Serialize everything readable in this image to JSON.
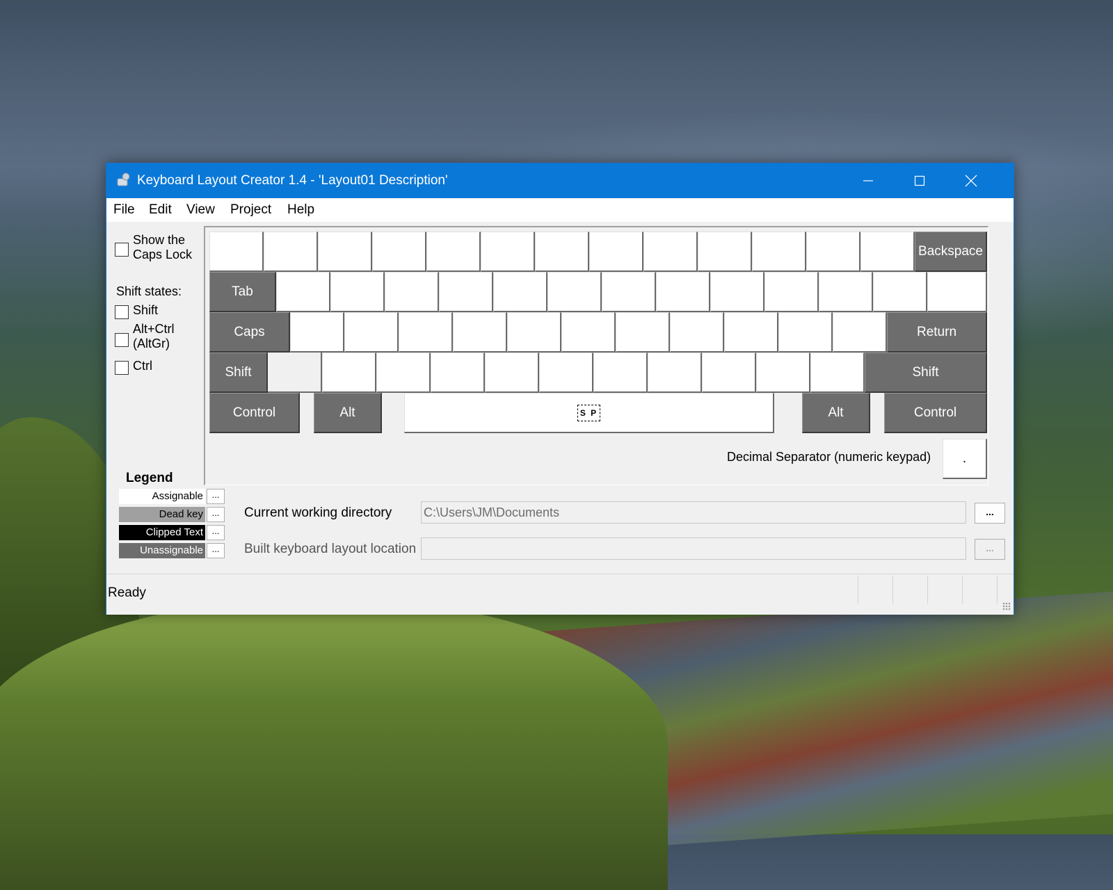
{
  "window": {
    "title": "Keyboard Layout Creator 1.4 - 'Layout01 Description'"
  },
  "menu": [
    "File",
    "Edit",
    "View",
    "Project",
    "Help"
  ],
  "side": {
    "caps_lock": [
      "Show the",
      "Caps Lock"
    ],
    "shift_states_title": "Shift states:",
    "shift": "Shift",
    "altgr": [
      "Alt+Ctrl",
      "(AltGr)"
    ],
    "ctrl": "Ctrl"
  },
  "keyboard": {
    "row1_last": "Backspace",
    "row2_first": "Tab",
    "row3_first": "Caps",
    "row3_last": "Return",
    "row4_first": "Shift",
    "row4_last": "Shift",
    "row5": [
      "Control",
      "Alt",
      "S P",
      "Alt",
      "Control"
    ],
    "decimal_label": "Decimal Separator (numeric keypad)",
    "decimal_value": "."
  },
  "legend": {
    "title": "Legend",
    "items": [
      "Assignable",
      "Dead key",
      "Clipped Text",
      "Unassignable"
    ],
    "button": "..."
  },
  "paths": {
    "cwd_label": "Current working directory",
    "cwd_value": "C:\\Users\\JM\\Documents",
    "built_label": "Built keyboard layout location",
    "built_value": "",
    "button": "..."
  },
  "status": {
    "text": "Ready"
  }
}
